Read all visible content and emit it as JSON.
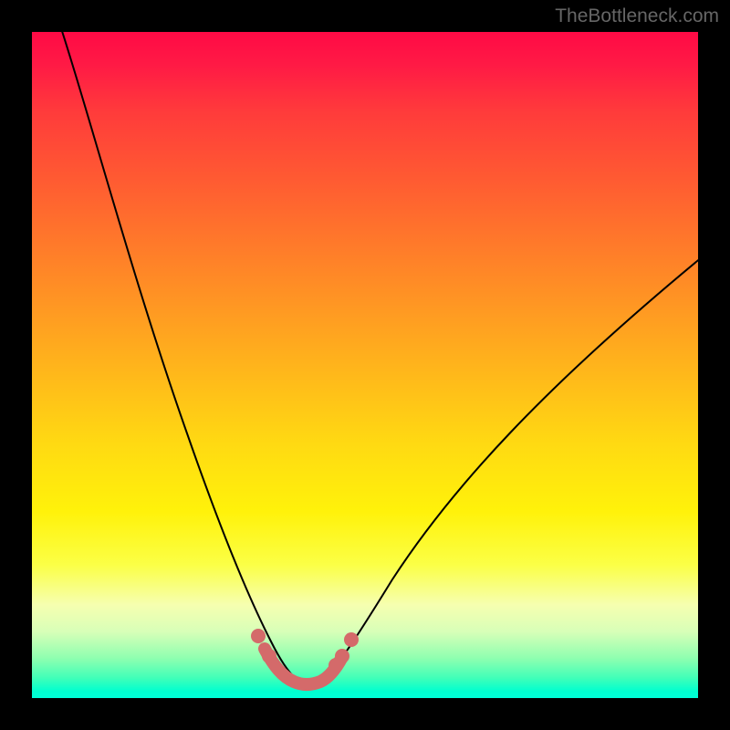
{
  "watermark": "TheBottleneck.com",
  "chart_data": {
    "type": "line",
    "title": "",
    "xlabel": "",
    "ylabel": "",
    "xlim": [
      0,
      100
    ],
    "ylim": [
      0,
      100
    ],
    "grid": false,
    "legend": false,
    "series": [
      {
        "name": "left-curve",
        "x": [
          4,
          8,
          12,
          16,
          20,
          24,
          28,
          30,
          32,
          34,
          35,
          36,
          37
        ],
        "y": [
          100,
          90,
          78,
          65,
          50,
          36,
          22,
          16,
          10,
          6,
          4,
          2.5,
          1.5
        ]
      },
      {
        "name": "right-curve",
        "x": [
          43,
          45,
          48,
          52,
          56,
          62,
          70,
          80,
          90,
          100
        ],
        "y": [
          1.5,
          4,
          8,
          14,
          20,
          28,
          38,
          49,
          59,
          67
        ]
      },
      {
        "name": "bottom-markers",
        "x": [
          32,
          34,
          36,
          37,
          38,
          39,
          40,
          41,
          42,
          43,
          44,
          45,
          46
        ],
        "y": [
          10,
          6,
          3,
          2,
          1.5,
          1.2,
          1.2,
          1.2,
          1.5,
          2,
          3,
          5,
          7
        ]
      }
    ],
    "colors": {
      "curve": "#000000",
      "markers": "#d46a6a",
      "gradient_top": "#ff0a45",
      "gradient_bottom": "#00ffd8"
    }
  }
}
